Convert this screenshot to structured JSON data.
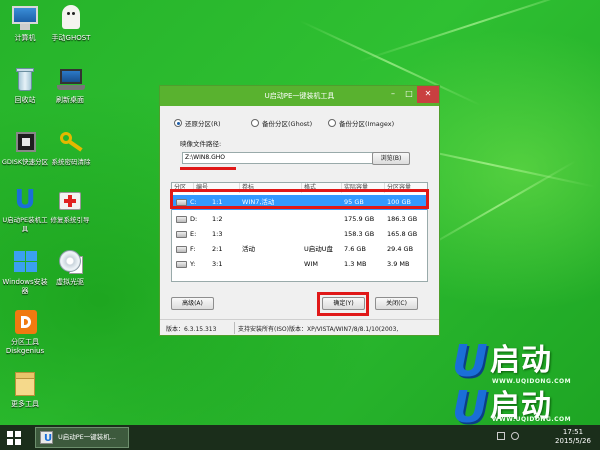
{
  "desktop_icons": [
    {
      "label": "计算机",
      "icon": "computer-icon"
    },
    {
      "label": "手动GHOST",
      "icon": "ghost-icon"
    },
    {
      "label": "回收站",
      "icon": "recycle-bin-icon"
    },
    {
      "label": "刷新桌面",
      "icon": "refresh-desktop-icon"
    },
    {
      "label": "GDISK快速分区",
      "icon": "gdisk-icon"
    },
    {
      "label": "系统密码清除",
      "icon": "key-icon"
    },
    {
      "label": "U启动PE装机工具",
      "label_line2": "工具",
      "icon": "u-start-icon"
    },
    {
      "label": "修复系统引导",
      "icon": "repair-kit-icon"
    },
    {
      "label": "Windows安装器",
      "icon": "windows-installer-icon"
    },
    {
      "label": "虚拟光驱",
      "icon": "virtual-drive-icon"
    },
    {
      "label": "分区工具Diskgenius",
      "icon": "diskgenius-icon"
    },
    {
      "label": "更多工具",
      "icon": "folder-icon"
    }
  ],
  "dialog": {
    "title": "U启动PE一键装机工具",
    "controls": {
      "minimize": "–",
      "maximize": "□",
      "close": "✕"
    },
    "radio_options": [
      {
        "label": "还原分区(R)",
        "checked": true
      },
      {
        "label": "备份分区(Ghost)",
        "checked": false
      },
      {
        "label": "备份分区(Imagex)",
        "checked": false
      }
    ],
    "image_path_label": "映像文件路径:",
    "image_path_value": "Z:\\WIN8.GHO",
    "browse_label": "浏览(B)",
    "table": {
      "columns": [
        "分区",
        "编号",
        "卷标",
        "格式",
        "实际容量",
        "分区容量"
      ],
      "rows": [
        {
          "drive": "C:",
          "num": "1:1",
          "label": "WIN7,活动",
          "fs": "",
          "used": "95 GB",
          "size": "100 GB",
          "selected": true
        },
        {
          "drive": "D:",
          "num": "1:2",
          "label": "",
          "fs": "",
          "used": "175.9 GB",
          "size": "186.3 GB",
          "selected": false
        },
        {
          "drive": "E:",
          "num": "1:3",
          "label": "",
          "fs": "",
          "used": "158.3 GB",
          "size": "165.8 GB",
          "selected": false
        },
        {
          "drive": "F:",
          "num": "2:1",
          "label": "活动",
          "fs": "U启动U盘",
          "used": "7.6 GB",
          "size": "29.4 GB",
          "selected": false
        },
        {
          "drive": "Y:",
          "num": "3:1",
          "label": "",
          "fs": "WIM",
          "used": "1.3 MB",
          "size": "3.9 MB",
          "selected": false
        }
      ]
    },
    "advanced_label": "高级(A)",
    "ok_label": "确定(Y)",
    "close_label": "关闭(C)",
    "status_version": "版本：6.3.15.313",
    "status_support": "支持安装所有(ISO)版本：XP/VISTA/WIN7/8/8.1/10(2003,"
  },
  "branding": {
    "logo_text": "启动",
    "logo_letter": "U",
    "url": "WWW.UQIDONG.COM"
  },
  "taskbar": {
    "task_label": "U启动PE一键装机...",
    "clock_time": "17:51",
    "clock_date": "2015/5/26"
  },
  "colors": {
    "desktop_green": "#2bb82b",
    "title_green": "#59b22f",
    "highlight": "#3399ff",
    "annotation_red": "#e01818",
    "logo_blue": "#1a6fd8"
  }
}
